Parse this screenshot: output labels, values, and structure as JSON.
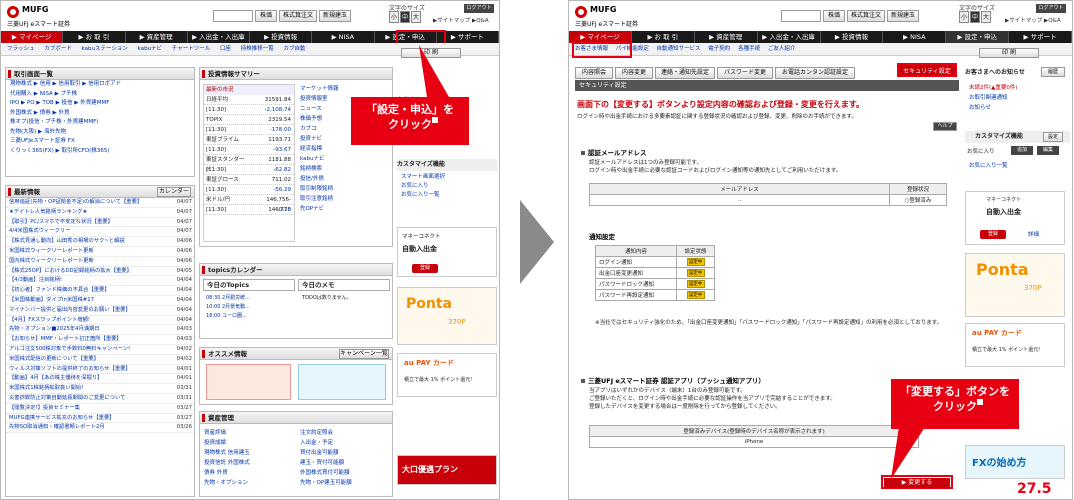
{
  "header": {
    "brand": "MUFG",
    "brand_sub": "三菱UFJ eスマート証券",
    "search_button": "株価",
    "quote_button": "株式箕注文",
    "ipo_button": "新規建玉",
    "font_size_label": "文字のサイズ",
    "font_small": "小",
    "font_mid": "中",
    "font_large": "大",
    "logout": "ログアウト",
    "top_links": "▶サイトマップ ▶Q&A"
  },
  "nav": {
    "items": [
      "▶ マイページ",
      "▶ お 取 引",
      "▶ 資産管理",
      "▶ 入出金・入出庫",
      "▶ 投資情報",
      "▶ NISA",
      "▶ 設定・申込",
      "▶ サポート"
    ]
  },
  "left": {
    "subnav": [
      "フラッシュ",
      "カブボード",
      "kabuステーション",
      "kabuナビ",
      "チャートツール",
      "口座",
      "持株推移一覧",
      "カブ自動"
    ],
    "print_button": "印 刷",
    "print_note": "(このページの印刷)",
    "trade_box": {
      "title": "取引画面一覧",
      "rows": [
        "現物株式 ▶ 信用 ▶ 信用取引 ▶ 信用ロボアド",
        "代用購入 ▶ NISA ▶ プチ株",
        "IPO ▶ PO ▶ TOB ▶ 投信 ▶ 外貨建MMF",
        "外国株式 ▶ 債券 ▶ 外貨",
        "株オプ(投信・プチ株・外貨建MMF)",
        "先物(大阪) ▶ 海外先物",
        "三菱UFJeスマート証券 FX",
        "くりっく365(FX) ▶ 取引所CFD(株365)"
      ]
    },
    "news_box": {
      "title": "最新情報",
      "calendar_button": "カレンダー",
      "items": [
        {
          "t": "信用追証(先物・OP証拠金不足)の解消について【重要】",
          "d": "04/07"
        },
        {
          "t": "★デイトレ人気銘柄ランキング★",
          "d": "04/07"
        },
        {
          "t": "【取引】PC/スマホで不安定な状況【重要】",
          "d": "04/07"
        },
        {
          "t": "4/4米国株式ウィークリー",
          "d": "04/07"
        },
        {
          "t": "【株式見通し動向】山田秀の相場のサク~と解説",
          "d": "04/06"
        },
        {
          "t": "米国株式ウィークリーレポート更新",
          "d": "04/06"
        },
        {
          "t": "国内株式ウィークリーレポート更新",
          "d": "04/06"
        },
        {
          "t": "【株式25OP】におけるDD記録銘柄の拡大【重要】",
          "d": "04/05"
        },
        {
          "t": "【4/3動画】注目銘柄!",
          "d": "04/04"
        },
        {
          "t": "【初心者】ファンド株価の不具合【重要】",
          "d": "04/04"
        },
        {
          "t": "【米国株動画】ダイプIn米国株#17",
          "d": "04/04"
        },
        {
          "t": "マイナンバー提供と届出内容変更のお願い【重要】",
          "d": "04/04"
        },
        {
          "t": "【4月】FXスワップポイント増額!",
          "d": "04/04"
        },
        {
          "t": "先物・オプション■2025年4月満期日",
          "d": "04/03"
        },
        {
          "t": "【お知らせ】MMF・レポート訂正箇所【重要】",
          "d": "04/03"
        },
        {
          "t": "アルゴ注文500株対象で手数料0無料キャンペーン!",
          "d": "04/02"
        },
        {
          "t": "米国株式配信の更新について【重要】",
          "d": "04/02"
        },
        {
          "t": "ウィルス対策ソフトの提供終了のお知らせ【重要】",
          "d": "04/01"
        },
        {
          "t": "【動画】4月【あの株主優待を深掘り】",
          "d": "04/01"
        },
        {
          "t": "米国株式1株銘柄拡取扱い開始!",
          "d": "03/31"
        },
        {
          "t": "災害詐欺防止対策自動延長期間のご変更について",
          "d": "03/31"
        },
        {
          "t": "【閲覧決定!】投資セミナー集",
          "d": "03/27"
        },
        {
          "t": "MUFG連携サービス拡充のお知らせ【重要】",
          "d": "03/27"
        },
        {
          "t": "先物SQ取消通知・確認書類レポート2月",
          "d": "03/26"
        }
      ]
    },
    "summary_box": {
      "title": "投資情報サマリー",
      "latest": "最新の市況",
      "rows": [
        {
          "n": "日経平均",
          "v": "31591.84"
        },
        {
          "n": "[11:30]",
          "v": "-2,108.74",
          "red": true
        },
        {
          "n": "TOPIX",
          "v": "2319.54"
        },
        {
          "n": "[11:30]",
          "v": "-178.00",
          "red": true
        },
        {
          "n": "東証プライム",
          "v": "1193.71"
        },
        {
          "n": "[11:30]",
          "v": "-93.67",
          "red": true
        },
        {
          "n": "東証スタンダード",
          "v": "1181.88"
        },
        {
          "n": "[11:30]",
          "v": "-62.82",
          "red": true
        },
        {
          "n": "東証グロース",
          "v": "711.02"
        },
        {
          "n": "[11:30]",
          "v": "-56.29",
          "red": true
        },
        {
          "n": "米ドル/円",
          "v": "146.756-146.770"
        },
        {
          "n": "[11:30]",
          "v": "-0.18",
          "red": true
        }
      ],
      "links": [
        "マーケット情報",
        "投資情報室",
        "ニュース",
        "株価予想",
        "カブコ",
        "投資ナビ",
        "経済指標",
        "kabuナビ",
        "銘柄検索",
        "投信/外債",
        "取引制限銘柄",
        "取引注意銘柄",
        "先OPナビ"
      ]
    },
    "topics_box": {
      "title": "topicsカレンダー",
      "today_topics": "今日のTopics",
      "today_memo": "今日のメモ",
      "items": [
        "08:30 2月勤労統...",
        "10:00 2月景気動...",
        "18:00 ユーロ圏..."
      ],
      "memo": "TODOは数りません。"
    },
    "osusume_box": {
      "title": "オススメ情報",
      "button": "キャンペーン一覧"
    },
    "asset_box": {
      "title": "資産管理",
      "col1": [
        "資産評価",
        "投資成績",
        "現物株式 信用建玉",
        "投資信託 外国株式",
        "債券 外貨",
        "先物・オプション"
      ],
      "col2": [
        "注文約定照会",
        "入出金・予定",
        "買付出金可能額",
        "建玉・買付可能額",
        "外国株式買付可能額",
        "先物・OP建玉可能額"
      ]
    },
    "right_col": {
      "title": "お客さま",
      "customize": "カスタマイズ機能",
      "links": [
        "スマート画面選択",
        "お気に入り",
        "お気に入り一覧"
      ],
      "mc_title": "マネーコネクト",
      "mc_sub": "自動入出金",
      "ponta": "Ponta",
      "ponta_pt": "370P",
      "aupay": "au PAY カード",
      "aupay_sub": "積立で最大 1% ポイント還元!",
      "dl_banner": "大口優遇プラン"
    },
    "callout": "「設定・申込」を\nクリック"
  },
  "right": {
    "subnav": [
      "お客さま情報",
      "パイ機能設定",
      "自動通知サービス",
      "電子契約",
      "各種手続",
      "ご友人紹介"
    ],
    "tabs": [
      "内容照会",
      "内容変更",
      "連絡・通知先設定",
      "パスワード変更",
      "お電話カンタン認証設定",
      "セキュリティ設定"
    ],
    "section_bar": "セキュリティ設定",
    "headline": "画面下の【変更する】ボタンより設定内容の確認および登録・変更を行えます。",
    "desc": "ログイン時や出金手続における多要素認証に関する登録状況の確認および登録、変更、削除のお手続ができます。",
    "help": "ヘルプ",
    "email_section": {
      "title": "認証メールアドレス",
      "desc1": "認証メールアドレスは1つのみ登録可能です。",
      "desc2": "ログイン時や出金手続に必要な認証コードおよびログイン通知等の通知先としてご利用いただけます。",
      "col1": "メールアドレス",
      "col2": "登録状況",
      "val": "..",
      "status": "○登録済み"
    },
    "notice_section": {
      "title": "通知設定",
      "col1": "通知内容",
      "col2": "設定状態",
      "rows": [
        "ログイン通知",
        "出金口座変更通知",
        "パスワードロック通知",
        "パスワード再設定通知"
      ],
      "badge": "設定中",
      "note": "※当社ではセキュリティ強化のため、「出金口座変更通知」「パスワードロック通知」「パスワード再設定通知」の利用を必須としております。"
    },
    "app_section": {
      "title": "三菱UFJ eスマート証券 認証アプリ（プッシュ通知アプリ）",
      "desc1": "当アプリはいずれかのデバイス（端末）1台のみ登録可能です。",
      "desc2": "ご登録いただくと、ログイン時や出金手続に必要な認証操作を当アプリで完結することができます。",
      "desc3": "登録したデバイスを変更する場合は一度削除を行ってから登録してください。",
      "col": "登録済みデバイス(登録時のデバイス名称が表示されます)",
      "device": "iPhone"
    },
    "change_button": "▶ 変更する",
    "side": {
      "notice_title": "お客さまへのお知らせ",
      "history": "履歴",
      "items": [
        "未読2件(▲重要0件)",
        "お取引関連通知",
        "お知らせ"
      ],
      "customize": "カスタマイズ機能",
      "setting": "設定",
      "fav": "お気に入り",
      "add": "追加",
      "edit": "編集",
      "fav_list": "お気に入り一覧",
      "mc_title": "マネーコネクト",
      "mc_sub": "自動入出金",
      "mc_btn": "登録",
      "detail": "詳細",
      "ponta": "Ponta",
      "ponta_pt": "370P",
      "aupay": "au PAY カード",
      "aupay_sub": "積立で最大 1% ポイント還元!",
      "fx": "FXの始め方",
      "bottom": "27.5"
    },
    "callout": "「変更する」ボタンを\nクリック"
  }
}
